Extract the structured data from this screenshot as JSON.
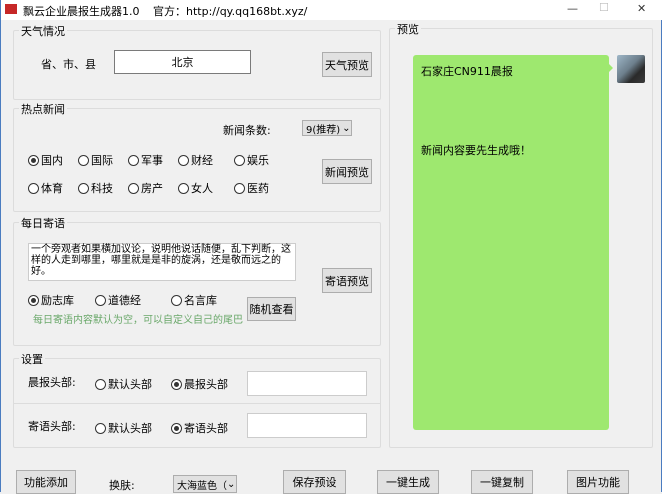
{
  "window": {
    "title": "飘云企业晨报生成器1.0",
    "official": "官方：http://qy.qq168bt.xyz/",
    "minimize": "—",
    "maximize": "☐",
    "close": "✕"
  },
  "weather": {
    "title": "天气情况",
    "label": "省、市、县",
    "value": "北京",
    "preview_button": "天气预览"
  },
  "news": {
    "title": "热点新闻",
    "count_label": "新闻条数:",
    "count_value": "9(推荐)",
    "preview_button": "新闻预览",
    "categories": [
      {
        "label": "国内",
        "checked": true
      },
      {
        "label": "国际",
        "checked": false
      },
      {
        "label": "军事",
        "checked": false
      },
      {
        "label": "财经",
        "checked": false
      },
      {
        "label": "娱乐",
        "checked": false
      },
      {
        "label": "体育",
        "checked": false
      },
      {
        "label": "科技",
        "checked": false
      },
      {
        "label": "房产",
        "checked": false
      },
      {
        "label": "女人",
        "checked": false
      },
      {
        "label": "医药",
        "checked": false
      }
    ]
  },
  "quote": {
    "title": "每日寄语",
    "text": "一个旁观者如果横加议论，说明他说话随便，乱下判断，这样的人走到哪里，哪里就是是非的旋涡，还是敬而远之的好。",
    "preview_button": "寄语预览",
    "sources": [
      {
        "label": "励志库",
        "checked": true
      },
      {
        "label": "道德经",
        "checked": false
      },
      {
        "label": "名言库",
        "checked": false
      }
    ],
    "random_button": "随机查看",
    "hint": "每日寄语内容默认为空，可以自定义自己的尾巴",
    "hint_color": "#6aa86a"
  },
  "settings": {
    "title": "设置",
    "rows": [
      {
        "label": "晨报头部:",
        "opt1": "默认头部",
        "opt2": "晨报头部",
        "value": ""
      },
      {
        "label": "寄语头部:",
        "opt1": "默认头部",
        "opt2": "寄语头部",
        "value": ""
      }
    ]
  },
  "preview": {
    "title": "预览",
    "line1": "石家庄CN911晨报",
    "line2": "新闻内容要先生成哦！",
    "bubble_color": "#9ee86f"
  },
  "bottom": {
    "add_button": "功能添加",
    "skin_label": "换肤:",
    "skin_value": "大海蓝色（",
    "save_button": "保存预设",
    "generate_button": "一键生成",
    "copy_button": "一键复制",
    "image_button": "图片功能"
  }
}
